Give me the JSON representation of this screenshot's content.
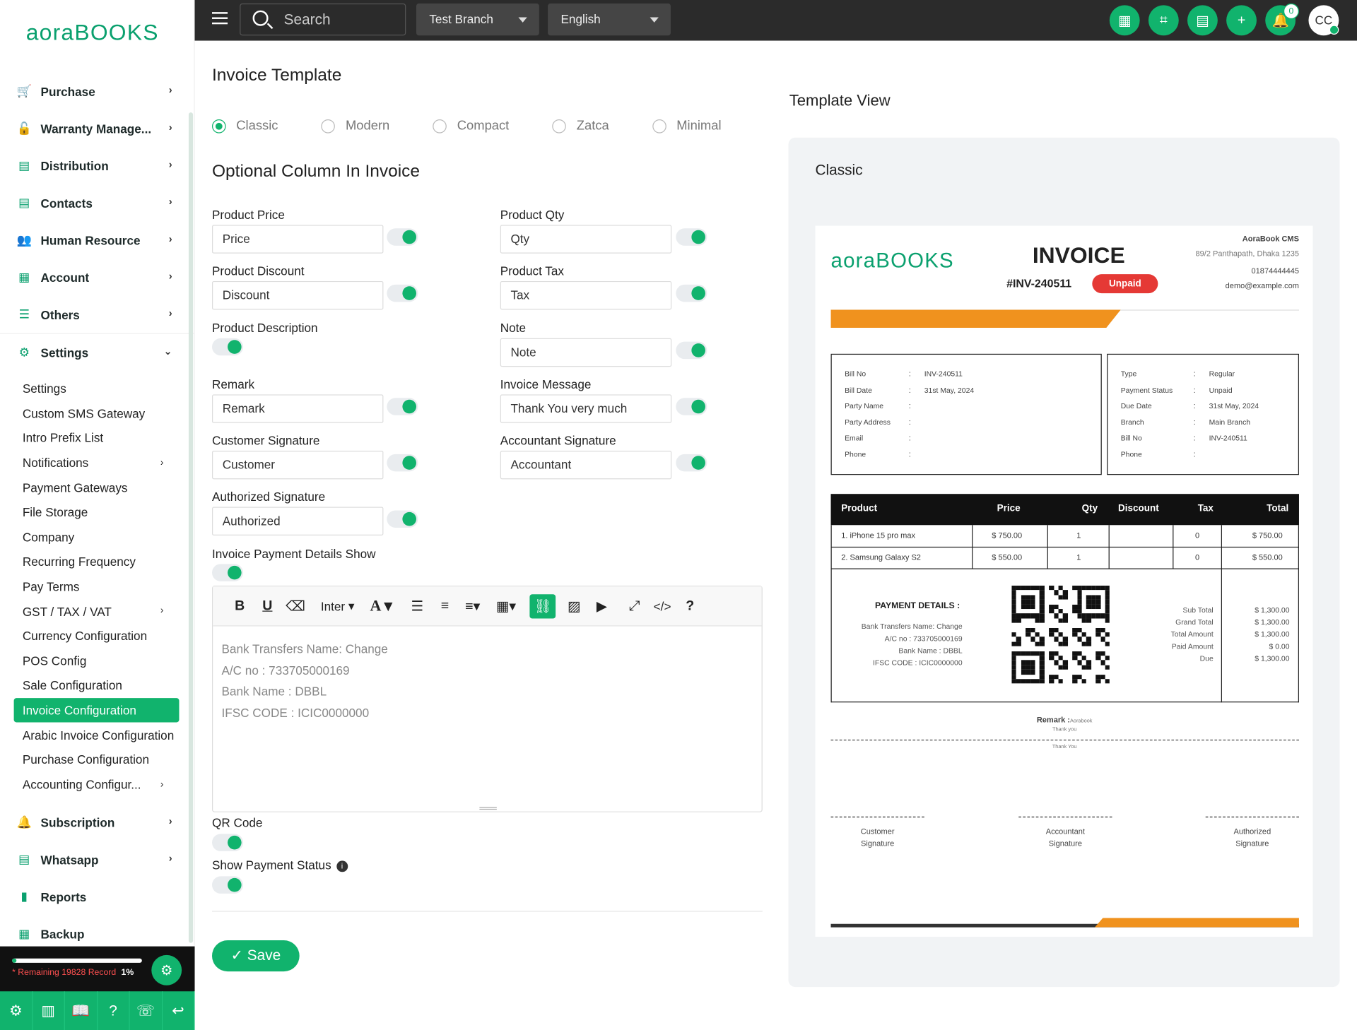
{
  "brand": {
    "logo": "aoraBOOKS",
    "accent": "#11b36d"
  },
  "sidebar": {
    "items": [
      {
        "label": "Purchase",
        "icon": "cart-icon"
      },
      {
        "label": "Warranty Manage...",
        "icon": "unlock-icon"
      },
      {
        "label": "Distribution",
        "icon": "file-icon"
      },
      {
        "label": "Contacts",
        "icon": "contact-file-icon"
      },
      {
        "label": "Human Resource",
        "icon": "users-icon"
      },
      {
        "label": "Account",
        "icon": "calculator-icon"
      },
      {
        "label": "Others",
        "icon": "list-icon"
      },
      {
        "label": "Settings",
        "icon": "gear-icon"
      }
    ],
    "settings_sub": [
      "Settings",
      "Custom SMS Gateway",
      "Intro Prefix List",
      "Notifications",
      "Payment Gateways",
      "File Storage",
      "Company",
      "Recurring Frequency",
      "Pay Terms",
      "GST / TAX / VAT",
      "Currency Configuration",
      "POS Config",
      "Sale Configuration",
      "Invoice Configuration",
      "Arabic Invoice Configuration",
      "Purchase Configuration",
      "Accounting Configur..."
    ],
    "items_after": [
      {
        "label": "Subscription",
        "icon": "bell-icon"
      },
      {
        "label": "Whatsapp",
        "icon": "file-icon"
      },
      {
        "label": "Reports",
        "icon": "bar-chart-icon"
      },
      {
        "label": "Backup",
        "icon": "grid-icon"
      }
    ],
    "footer": {
      "remaining": "* Remaining 19828 Record",
      "percent": "1%",
      "progress": 0.01
    }
  },
  "topbar": {
    "search_placeholder": "Search",
    "branch": "Test Branch",
    "language": "English",
    "notification_count": "0",
    "avatar_initials": "CC"
  },
  "main": {
    "title": "Invoice Template",
    "templates": [
      "Classic",
      "Modern",
      "Compact",
      "Zatca",
      "Minimal"
    ],
    "selected_template": "Classic",
    "optional_title": "Optional Column In Invoice",
    "fields": {
      "product_price": {
        "label": "Product Price",
        "value": "Price"
      },
      "product_qty": {
        "label": "Product Qty",
        "value": "Qty"
      },
      "product_discount": {
        "label": "Product Discount",
        "value": "Discount"
      },
      "product_tax": {
        "label": "Product Tax",
        "value": "Tax"
      },
      "product_description": {
        "label": "Product Description"
      },
      "note": {
        "label": "Note",
        "value": "Note"
      },
      "remark": {
        "label": "Remark",
        "value": "Remark"
      },
      "invoice_message": {
        "label": "Invoice Message",
        "value": "Thank You very much"
      },
      "customer_signature": {
        "label": "Customer Signature",
        "value": "Customer"
      },
      "accountant_signature": {
        "label": "Accountant Signature",
        "value": "Accountant"
      },
      "authorized_signature": {
        "label": "Authorized Signature",
        "value": "Authorized"
      },
      "payment_details_show": {
        "label": "Invoice Payment Details Show"
      },
      "qr_code": {
        "label": "QR Code"
      },
      "show_payment_status": {
        "label": "Show Payment Status"
      }
    },
    "editor": {
      "font": "Inter",
      "lines": [
        "Bank Transfers Name: Change",
        "A/C no : 733705000169",
        "Bank Name : DBBL",
        "IFSC CODE : ICIC0000000"
      ]
    },
    "save_label": "Save"
  },
  "preview": {
    "title": "Template View",
    "template_name": "Classic",
    "invoice": {
      "heading": "INVOICE",
      "number": "#INV-240511",
      "status": "Unpaid",
      "company": "AoraBook CMS",
      "address": "89/2 Panthapath, Dhaka 1235",
      "phone": "01874444445",
      "email": "demo@example.com",
      "bill_left": [
        [
          "Bill No",
          "INV-240511"
        ],
        [
          "Bill Date",
          "31st May, 2024"
        ],
        [
          "Party Name",
          ""
        ],
        [
          "Party Address",
          ""
        ],
        [
          "Email",
          ""
        ],
        [
          "Phone",
          ""
        ]
      ],
      "bill_right": [
        [
          "Type",
          "Regular"
        ],
        [
          "Payment Status",
          "Unpaid"
        ],
        [
          "Due Date",
          "31st May, 2024"
        ],
        [
          "Branch",
          "Main Branch"
        ],
        [
          "Bill No",
          "INV-240511"
        ],
        [
          "Phone",
          ""
        ]
      ],
      "columns": [
        "Product",
        "Price",
        "Qty",
        "Discount",
        "Tax",
        "Total"
      ],
      "rows": [
        [
          "1. iPhone 15 pro max",
          "$ 750.00",
          "1",
          "",
          "0",
          "$ 750.00"
        ],
        [
          "2. Samsung Galaxy S2",
          "$ 550.00",
          "1",
          "",
          "0",
          "$ 550.00"
        ]
      ],
      "payment_title": "PAYMENT DETAILS :",
      "payment_lines": [
        "Bank Transfers Name: Change",
        "A/C no : 733705000169",
        "Bank Name : DBBL",
        "IFSC CODE : ICIC0000000"
      ],
      "totals": [
        [
          "Sub Total",
          "$ 1,300.00"
        ],
        [
          "Grand Total",
          "$ 1,300.00"
        ],
        [
          "Total Amount",
          "$ 1,300.00"
        ],
        [
          "Paid Amount",
          "$ 0.00"
        ],
        [
          "Due",
          "$ 1,300.00"
        ]
      ],
      "remark_label": "Remark :",
      "remark_value": "Aorabook",
      "thank_you_1": "Thank you",
      "thank_you_2": "Thank You",
      "signatures": [
        [
          "Customer",
          "Signature"
        ],
        [
          "Accountant",
          "Signature"
        ],
        [
          "Authorized",
          "Signature"
        ]
      ],
      "accent_orange": "#f0921e"
    }
  }
}
